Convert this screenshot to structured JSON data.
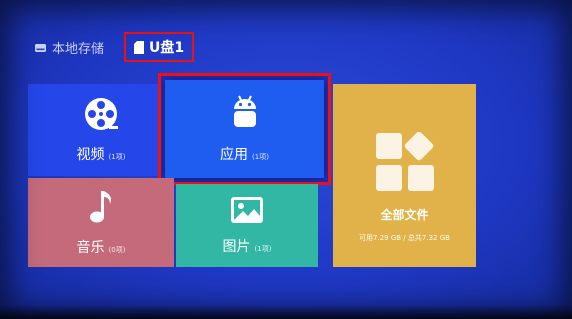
{
  "tabs": {
    "local": {
      "label": "本地存储",
      "icon": "drive-icon"
    },
    "usb": {
      "label": "U盘1",
      "icon": "sd-card-icon"
    }
  },
  "tiles": {
    "video": {
      "name": "视频",
      "count": "(1项)",
      "icon": "film-reel-icon",
      "color": "#2547e9"
    },
    "apps": {
      "name": "应用",
      "count": "(1项)",
      "icon": "android-icon",
      "color": "#1f5cf0"
    },
    "music": {
      "name": "音乐",
      "count": "(0项)",
      "icon": "music-note-icon",
      "color": "#c46a7a"
    },
    "photos": {
      "name": "图片",
      "count": "(1项)",
      "icon": "picture-icon",
      "color": "#32b7a4"
    },
    "files": {
      "name": "全部文件",
      "storage": "可用7.29 GB / 总共7.32 GB",
      "icon": "grid-blocks-icon",
      "color": "#e1b24a"
    }
  },
  "colors": {
    "focus_border": "#e11111",
    "background": "#1f38c4"
  }
}
